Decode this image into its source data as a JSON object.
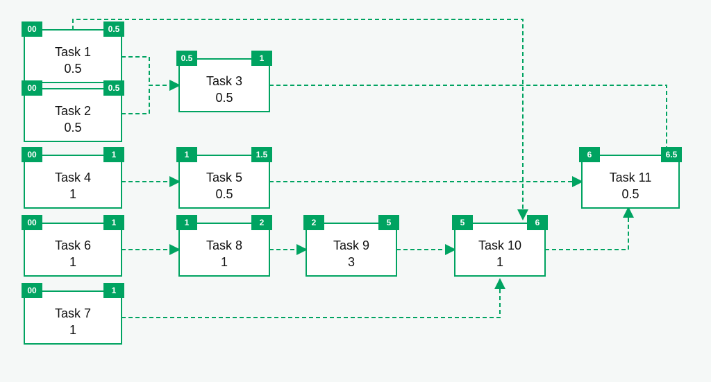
{
  "nodes": {
    "t1": {
      "label": "Task 1",
      "dur": "0.5",
      "start": "00",
      "end": "0.5"
    },
    "t2": {
      "label": "Task 2",
      "dur": "0.5",
      "start": "00",
      "end": "0.5"
    },
    "t3": {
      "label": "Task 3",
      "dur": "0.5",
      "start": "0.5",
      "end": "1"
    },
    "t4": {
      "label": "Task 4",
      "dur": "1",
      "start": "00",
      "end": "1"
    },
    "t5": {
      "label": "Task 5",
      "dur": "0.5",
      "start": "1",
      "end": "1.5"
    },
    "t6": {
      "label": "Task 6",
      "dur": "1",
      "start": "00",
      "end": "1"
    },
    "t7": {
      "label": "Task 7",
      "dur": "1",
      "start": "00",
      "end": "1"
    },
    "t8": {
      "label": "Task 8",
      "dur": "1",
      "start": "1",
      "end": "2"
    },
    "t9": {
      "label": "Task 9",
      "dur": "3",
      "start": "2",
      "end": "5"
    },
    "t10": {
      "label": "Task 10",
      "dur": "1",
      "start": "5",
      "end": "6"
    },
    "t11": {
      "label": "Task 11",
      "dur": "0.5",
      "start": "6",
      "end": "6.5"
    }
  },
  "edges": [
    {
      "from": "t1",
      "to": "t10"
    },
    {
      "from": "t1",
      "to": "t3"
    },
    {
      "from": "t2",
      "to": "t3"
    },
    {
      "from": "t3",
      "to": "t11"
    },
    {
      "from": "t4",
      "to": "t5"
    },
    {
      "from": "t5",
      "to": "t11"
    },
    {
      "from": "t6",
      "to": "t8"
    },
    {
      "from": "t8",
      "to": "t9"
    },
    {
      "from": "t9",
      "to": "t10"
    },
    {
      "from": "t10",
      "to": "t11"
    },
    {
      "from": "t7",
      "to": "t10"
    }
  ],
  "colors": {
    "accent": "#00a361",
    "bg": "#f5f8f7"
  }
}
